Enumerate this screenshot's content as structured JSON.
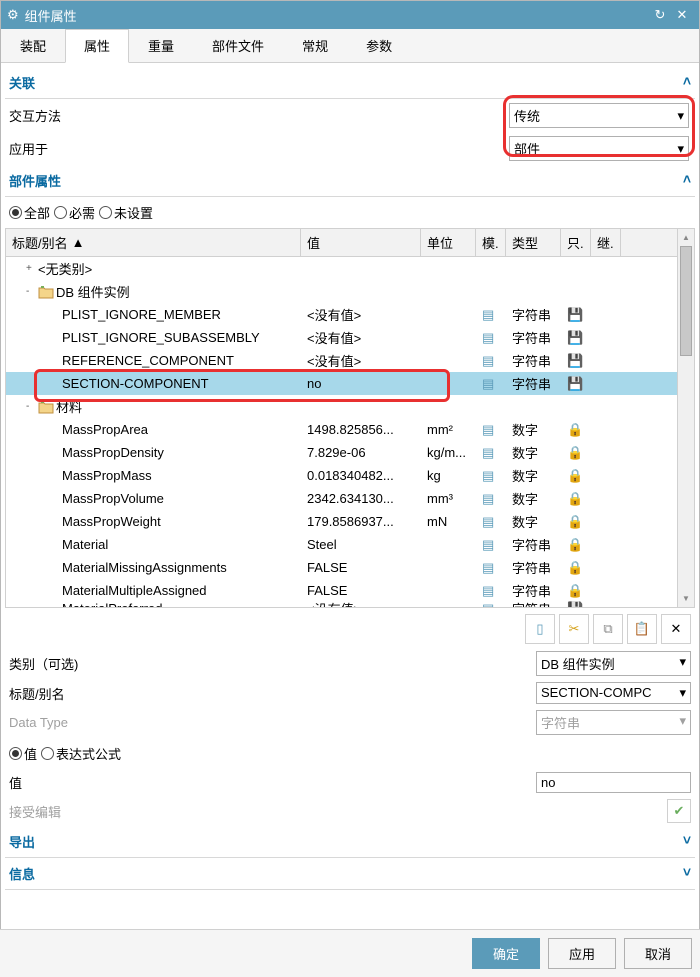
{
  "titlebar": {
    "title": "组件属性"
  },
  "tabs": [
    "装配",
    "属性",
    "重量",
    "部件文件",
    "常规",
    "参数"
  ],
  "active_tab": 1,
  "section_assoc": {
    "title": "关联",
    "rows": [
      {
        "label": "交互方法",
        "value": "传统"
      },
      {
        "label": "应用于",
        "value": "部件"
      }
    ]
  },
  "section_props": {
    "title": "部件属性",
    "radios": [
      "全部",
      "必需",
      "未设置"
    ],
    "radio_checked": 0,
    "columns": [
      "标题/别名",
      "值",
      "单位",
      "模.",
      "类型",
      "只.",
      "继."
    ],
    "groups": [
      {
        "expand": "+",
        "label": "<无类别>",
        "folder": false,
        "indent": 12
      },
      {
        "expand": "-",
        "label": "DB 组件实例",
        "folder": true,
        "indent": 12,
        "rows": [
          {
            "name": "PLIST_IGNORE_MEMBER",
            "val": "<没有值>",
            "unit": "",
            "type": "字符串",
            "lock": "save"
          },
          {
            "name": "PLIST_IGNORE_SUBASSEMBLY",
            "val": "<没有值>",
            "unit": "",
            "type": "字符串",
            "lock": "save"
          },
          {
            "name": "REFERENCE_COMPONENT",
            "val": "<没有值>",
            "unit": "",
            "type": "字符串",
            "lock": "save"
          },
          {
            "name": "SECTION-COMPONENT",
            "val": "no",
            "unit": "",
            "type": "字符串",
            "lock": "save",
            "sel": true,
            "hl": true
          }
        ]
      },
      {
        "expand": "-",
        "label": "材料",
        "folder": true,
        "indent": 12,
        "rows": [
          {
            "name": "MassPropArea",
            "val": "1498.825856...",
            "unit": "mm²",
            "type": "数字",
            "lock": "lock"
          },
          {
            "name": "MassPropDensity",
            "val": "7.829e-06",
            "unit": "kg/m...",
            "type": "数字",
            "lock": "lock"
          },
          {
            "name": "MassPropMass",
            "val": "0.018340482...",
            "unit": "kg",
            "type": "数字",
            "lock": "lock"
          },
          {
            "name": "MassPropVolume",
            "val": "2342.634130...",
            "unit": "mm³",
            "type": "数字",
            "lock": "lock"
          },
          {
            "name": "MassPropWeight",
            "val": "179.8586937...",
            "unit": "mN",
            "type": "数字",
            "lock": "lock"
          },
          {
            "name": "Material",
            "val": "Steel",
            "unit": "",
            "type": "字符串",
            "lock": "lock"
          },
          {
            "name": "MaterialMissingAssignments",
            "val": "FALSE",
            "unit": "",
            "type": "字符串",
            "lock": "lock"
          },
          {
            "name": "MaterialMultipleAssigned",
            "val": "FALSE",
            "unit": "",
            "type": "字符串",
            "lock": "lock"
          },
          {
            "name": "MaterialPreferred",
            "val": "<没有值>",
            "unit": "",
            "type": "字符串",
            "lock": "save",
            "partial": true
          }
        ]
      }
    ]
  },
  "detail": {
    "category_label": "类别（可选)",
    "category_value": "DB 组件实例",
    "alias_label": "标题/别名",
    "alias_value": "SECTION-COMPC",
    "datatype_label": "Data Type",
    "datatype_value": "字符串",
    "val_radios": [
      "值",
      "表达式公式"
    ],
    "val_radio_checked": 0,
    "value_label": "值",
    "value_value": "no",
    "accept_label": "接受编辑"
  },
  "collapsed": [
    {
      "title": "导出"
    },
    {
      "title": "信息"
    }
  ],
  "footer": {
    "ok": "确定",
    "apply": "应用",
    "cancel": "取消"
  }
}
